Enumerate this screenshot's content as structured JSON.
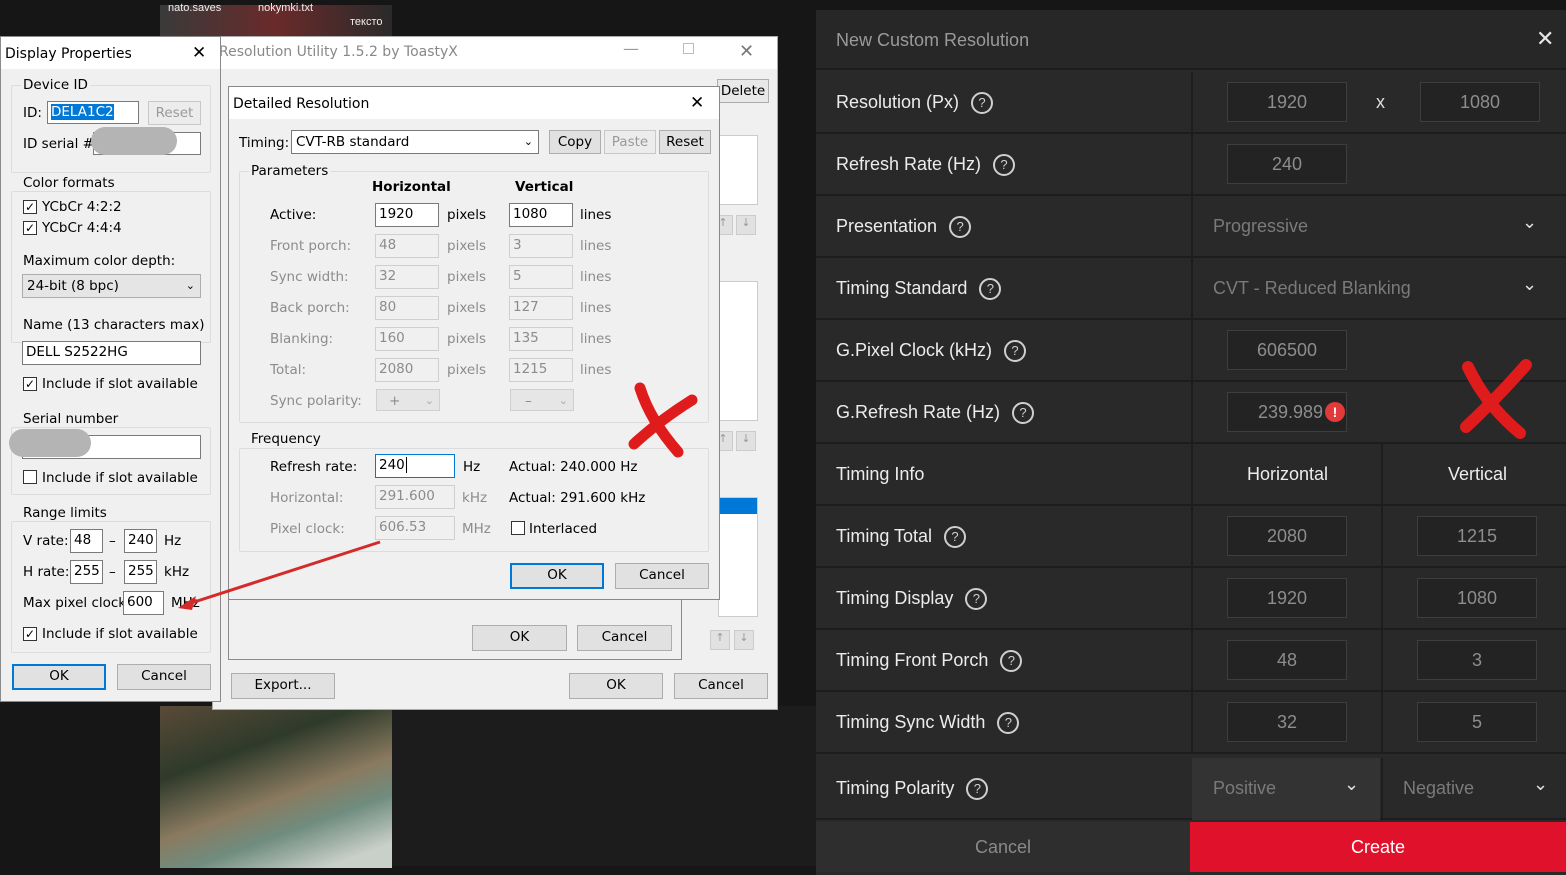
{
  "desktop": {
    "file_labels": [
      "nato.saves",
      "nokymki.txt",
      "тексто"
    ]
  },
  "display_properties": {
    "title": "Display Properties",
    "device_id_label": "Device ID",
    "id_label": "ID:",
    "id_value": "DELA1C2",
    "reset": "Reset",
    "id_serial_label": "ID serial #:",
    "color_formats_label": "Color formats",
    "ycbcr422": "YCbCr 4:2:2",
    "ycbcr444": "YCbCr 4:4:4",
    "max_color_depth_label": "Maximum color depth:",
    "max_color_depth_value": "24-bit (8 bpc)",
    "name_label": "Name (13 characters max)",
    "name_value": "DELL S2522HG",
    "include1": "Include if slot available",
    "serial_label": "Serial number",
    "include2": "Include if slot available",
    "range_label": "Range limits",
    "vrate_label": "V rate:",
    "vrate_min": "48",
    "vrate_max": "240",
    "hz": "Hz",
    "hrate_label": "H rate:",
    "hrate_min": "255",
    "hrate_max": "255",
    "khz": "kHz",
    "dash": "–",
    "max_pixel_clock_label": "Max pixel clock:",
    "max_pixel_clock": "600",
    "mhz": "MHz",
    "include3": "Include if slot available",
    "ok": "OK",
    "cancel": "Cancel"
  },
  "cru": {
    "title": "Resolution Utility 1.5.2 by ToastyX",
    "delete": "Delete",
    "export": "Export...",
    "ok": "OK",
    "cancel": "Cancel",
    "ok2": "OK",
    "cancel2": "Cancel"
  },
  "detailed": {
    "title": "Detailed Resolution",
    "timing_label": "Timing:",
    "timing_value": "CVT-RB standard",
    "copy": "Copy",
    "paste": "Paste",
    "reset": "Reset",
    "parameters_label": "Parameters",
    "horizontal": "Horizontal",
    "vertical": "Vertical",
    "pixels": "pixels",
    "lines": "lines",
    "rows": [
      {
        "label": "Active:",
        "h": "1920",
        "v": "1080"
      },
      {
        "label": "Front porch:",
        "h": "48",
        "v": "3"
      },
      {
        "label": "Sync width:",
        "h": "32",
        "v": "5"
      },
      {
        "label": "Back porch:",
        "h": "80",
        "v": "127"
      },
      {
        "label": "Blanking:",
        "h": "160",
        "v": "135"
      },
      {
        "label": "Total:",
        "h": "2080",
        "v": "1215"
      }
    ],
    "sync_polarity_label": "Sync polarity:",
    "sync_h": "+",
    "sync_v": "–",
    "frequency_label": "Frequency",
    "refresh_label": "Refresh rate:",
    "refresh_value": "240",
    "hz": "Hz",
    "actual_refresh": "Actual: 240.000 Hz",
    "horizontal_label": "Horizontal:",
    "horizontal_value": "291.600",
    "khz": "kHz",
    "actual_horizontal": "Actual: 291.600 kHz",
    "pixel_clock_label": "Pixel clock:",
    "pixel_clock_value": "606.53",
    "mhz": "MHz",
    "interlaced": "Interlaced",
    "ok": "OK",
    "cancel": "Cancel"
  },
  "amd": {
    "title": "New Custom Resolution",
    "resolution_label": "Resolution (Px)",
    "res_w": "1920",
    "x": "x",
    "res_h": "1080",
    "refresh_label": "Refresh Rate (Hz)",
    "refresh_value": "240",
    "presentation_label": "Presentation",
    "presentation_value": "Progressive",
    "timing_standard_label": "Timing Standard",
    "timing_standard_value": "CVT - Reduced Blanking",
    "pixel_clock_label": "G.Pixel Clock (kHz)",
    "pixel_clock_value": "606500",
    "grefresh_label": "G.Refresh Rate (Hz)",
    "grefresh_value": "239.989",
    "timing_info_label": "Timing Info",
    "horizontal": "Horizontal",
    "vertical": "Vertical",
    "timing_total_label": "Timing Total",
    "total_h": "2080",
    "total_v": "1215",
    "timing_display_label": "Timing Display",
    "display_h": "1920",
    "display_v": "1080",
    "front_porch_label": "Timing Front Porch",
    "fp_h": "48",
    "fp_v": "3",
    "sync_width_label": "Timing Sync Width",
    "sw_h": "32",
    "sw_v": "5",
    "polarity_label": "Timing Polarity",
    "polarity_h": "Positive",
    "polarity_v": "Negative",
    "cancel": "Cancel",
    "create": "Create",
    "accent": "#e0112b"
  }
}
